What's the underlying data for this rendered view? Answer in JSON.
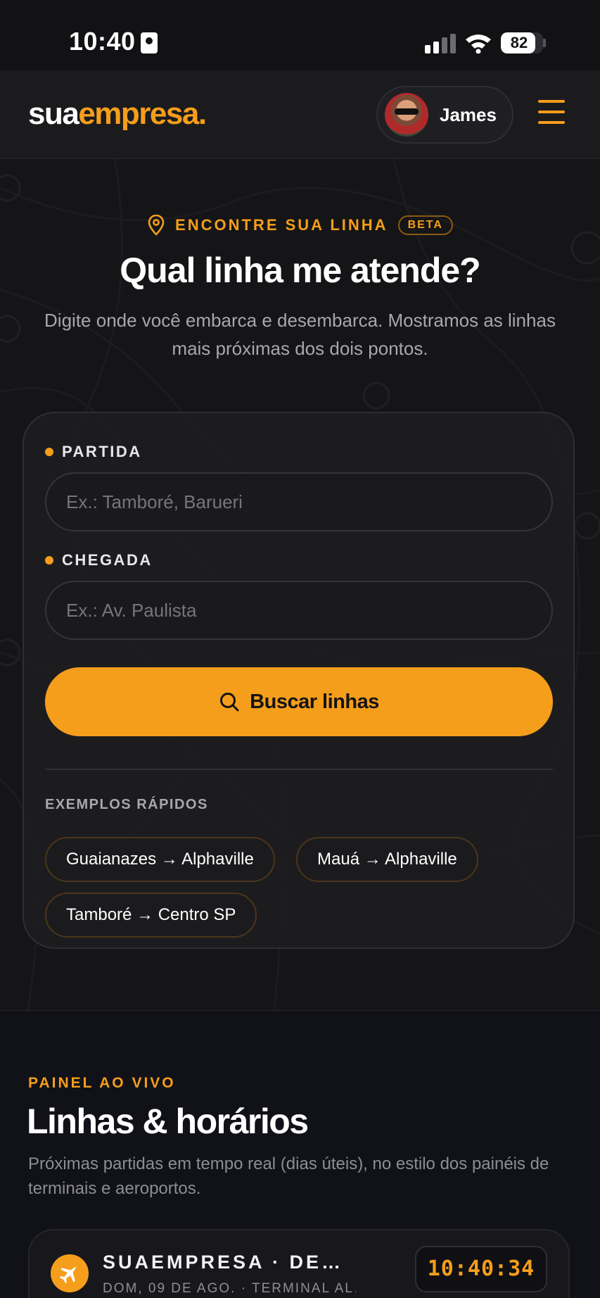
{
  "status_bar": {
    "time": "10:40",
    "battery": "82",
    "battery_level": 0.82
  },
  "header": {
    "logo_part1": "sua",
    "logo_part2": "empresa.",
    "user_name": "James"
  },
  "hero": {
    "eyebrow": "ENCONTRE SUA LINHA",
    "badge": "BETA",
    "title": "Qual linha me atende?",
    "subtitle": "Digite onde você embarca e desembarca. Mostramos as linhas mais próximas dos dois pontos."
  },
  "form": {
    "departure_label": "PARTIDA",
    "departure_placeholder": "Ex.: Tamboré, Barueri",
    "departure_value": "",
    "arrival_label": "CHEGADA",
    "arrival_placeholder": "Ex.: Av. Paulista",
    "arrival_value": "",
    "search_label": "Buscar linhas",
    "examples_label": "EXEMPLOS RÁPIDOS",
    "examples": [
      "Guaianazes → Alphaville",
      "Mauá → Alphaville",
      "Tamboré → Centro SP"
    ]
  },
  "live_panel": {
    "eyebrow": "PAINEL AO VIVO",
    "title": "Linhas & horários",
    "subtitle": "Próximas partidas em tempo real (dias úteis), no estilo dos painéis de terminais e aeroportos.",
    "board_name": "SUAEMPRESA · DE…",
    "board_meta": "DOM, 09 DE AGO. · TERMINAL AL…",
    "clock": "10:40:34"
  },
  "colors": {
    "accent": "#f59e1b",
    "background": "#141416",
    "card": "#1d1d21",
    "muted_text": "#a7a7ad"
  },
  "icons": {
    "status_id": "contact-card-icon",
    "signal": "cellular-signal-icon",
    "wifi": "wifi-icon",
    "menu": "hamburger-menu-icon",
    "location": "map-pin-icon",
    "search": "search-icon",
    "board": "airplane-icon"
  }
}
